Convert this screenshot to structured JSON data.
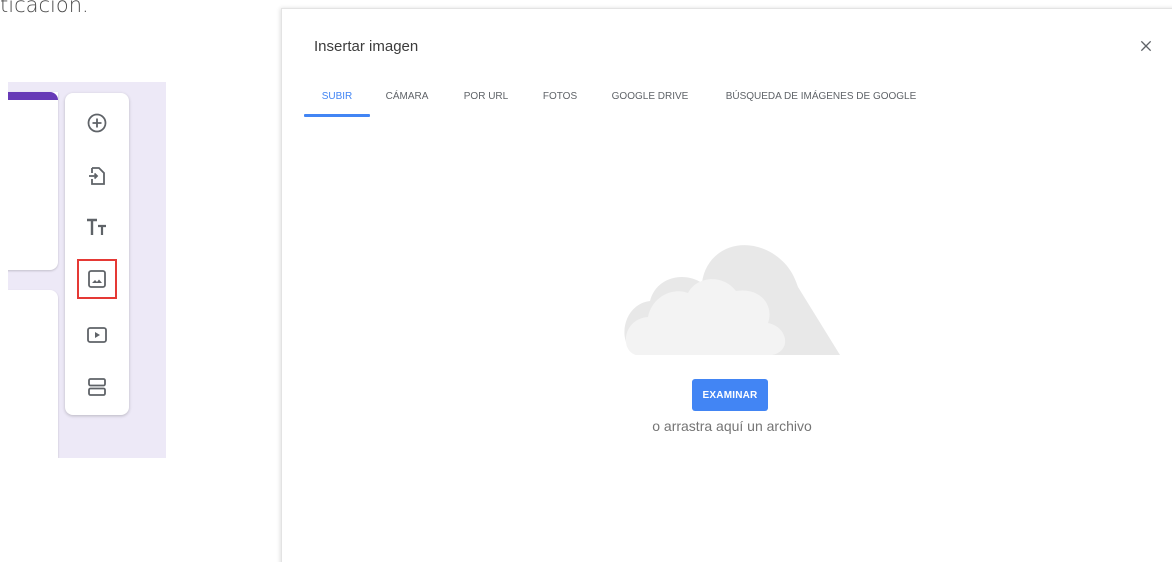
{
  "caption": {
    "text": "ticación."
  },
  "editor": {
    "colors": {
      "background": "#ede9f7",
      "accent": "#673ab7",
      "highlight": "#e53935"
    },
    "toolbar": [
      {
        "icon": "add-circle-icon",
        "label": "Agregar pregunta"
      },
      {
        "icon": "import-icon",
        "label": "Importar preguntas"
      },
      {
        "icon": "title-text-icon",
        "label": "Agregar título y descripción"
      },
      {
        "icon": "image-icon",
        "label": "Agregar imagen",
        "selected": true
      },
      {
        "icon": "video-icon",
        "label": "Agregar video"
      },
      {
        "icon": "section-icon",
        "label": "Agregar sección"
      }
    ]
  },
  "dialog": {
    "title": "Insertar imagen",
    "close_icon": "close-icon",
    "tabs": [
      {
        "label": "SUBIR",
        "active": true
      },
      {
        "label": "CÁMARA",
        "active": false
      },
      {
        "label": "POR URL",
        "active": false
      },
      {
        "label": "FOTOS",
        "active": false
      },
      {
        "label": "GOOGLE DRIVE",
        "active": false
      },
      {
        "label": "BÚSQUEDA DE IMÁGENES DE GOOGLE",
        "active": false
      }
    ],
    "upload": {
      "illustration_icon": "cloud-icon",
      "browse_label": "EXAMINAR",
      "drop_hint": "o arrastra aquí un archivo"
    },
    "colors": {
      "primary": "#4285f4"
    }
  }
}
